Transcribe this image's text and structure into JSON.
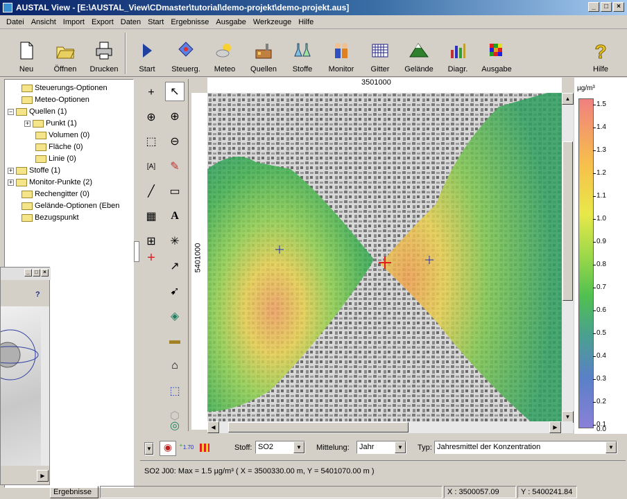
{
  "window": {
    "title": "AUSTAL View - [E:\\AUSTAL_View\\CDmaster\\tutorial\\demo-projekt\\demo-projekt.aus]"
  },
  "menu": [
    "Datei",
    "Ansicht",
    "Import",
    "Export",
    "Daten",
    "Start",
    "Ergebnisse",
    "Ausgabe",
    "Werkzeuge",
    "Hilfe"
  ],
  "toolbar": {
    "neu": "Neu",
    "oeffnen": "Öffnen",
    "drucken": "Drucken",
    "start": "Start",
    "steuerg": "Steuerg.",
    "meteo": "Meteo",
    "quellen": "Quellen",
    "stoffe": "Stoffe",
    "monitor": "Monitor",
    "gitter": "Gitter",
    "gelaende": "Gelände",
    "diagr": "Diagr.",
    "ausgabe": "Ausgabe",
    "hilfe": "Hilfe"
  },
  "tree": [
    "Steuerungs-Optionen",
    "Meteo-Optionen",
    "Quellen (1)",
    "Punkt (1)",
    "Volumen (0)",
    "Fläche (0)",
    "Linie (0)",
    "Stoffe (1)",
    "Monitor-Punkte (2)",
    "Rechengitter (0)",
    "Gelände-Optionen (Eben",
    "Bezugspunkt"
  ],
  "map": {
    "x_label": "3501000",
    "y_label": "5401000"
  },
  "legend": {
    "unit": "µg/m³",
    "ticks": [
      "1.5",
      "1.4",
      "1.3",
      "1.2",
      "1.1",
      "1.0",
      "0.9",
      "0.8",
      "0.7",
      "0.6",
      "0.5",
      "0.4",
      "0.3",
      "0.2",
      "0.1",
      "0.0"
    ]
  },
  "options": {
    "stoff_label": "Stoff:",
    "stoff_value": "SO2",
    "mittelung_label": "Mittelung:",
    "mittelung_value": "Jahr",
    "typ_label": "Typ:",
    "typ_value": "Jahresmittel der Konzentration",
    "subscript": "1.70"
  },
  "result_line": "SO2 J00:  Max = 1.5 µg/m³  ( X = 3500330.00 m, Y = 5401070.00 m )",
  "status": {
    "tab": "Ergebnisse",
    "x": "X : 3500057.09",
    "y": "Y : 5400241.84"
  },
  "floatwin": {
    "help": "?"
  }
}
